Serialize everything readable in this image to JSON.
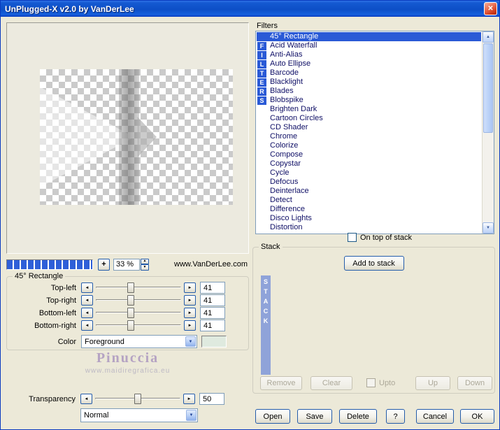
{
  "window": {
    "title": "UnPlugged-X v2.0 by VanDerLee"
  },
  "icons": {
    "close": "✕",
    "left": "◄",
    "right": "►",
    "up": "▲",
    "down": "▼",
    "dropdown": "▼",
    "plus": "+"
  },
  "preview": {
    "zoom": "33 %",
    "website": "www.VanDerLee.com"
  },
  "filters": {
    "label": "Filters",
    "letters": [
      "F",
      "I",
      "L",
      "T",
      "E",
      "R",
      "S"
    ],
    "items": [
      "45° Rectangle",
      "Acid Waterfall",
      "Anti-Alias",
      "Auto Ellipse",
      "Barcode",
      "Blacklight",
      "Blades",
      "Blobspike",
      "Brighten Dark",
      "Cartoon Circles",
      "CD Shader",
      "Chrome",
      "Colorize",
      "Compose",
      "Copystar",
      "Cycle",
      "Defocus",
      "Deinterlace",
      "Detect",
      "Difference",
      "Disco Lights",
      "Distortion"
    ],
    "selected_item": "45° Rectangle",
    "on_top_label": "On top of stack"
  },
  "settings": {
    "group_title": "45° Rectangle",
    "sliders": [
      {
        "label": "Top-left",
        "value": "41"
      },
      {
        "label": "Top-right",
        "value": "41"
      },
      {
        "label": "Bottom-left",
        "value": "41"
      },
      {
        "label": "Bottom-right",
        "value": "41"
      }
    ],
    "color_label": "Color",
    "color_value": "Foreground",
    "transparency": {
      "label": "Transparency",
      "value": "50"
    },
    "blend_mode": "Normal"
  },
  "watermark": {
    "name": "Pinuccia",
    "site": "www.maidiregrafica.eu"
  },
  "stack": {
    "group_title": "Stack",
    "add_button": "Add to stack",
    "letters": [
      "S",
      "T",
      "A",
      "C",
      "K"
    ],
    "remove": "Remove",
    "clear": "Clear",
    "upto": "Upto",
    "up": "Up",
    "down": "Down"
  },
  "footer": {
    "open": "Open",
    "save": "Save",
    "delete": "Delete",
    "help": "?",
    "cancel": "Cancel",
    "ok": "OK"
  },
  "colors": {
    "titlebar": "#0d4fc7",
    "selection": "#2a5ad6",
    "dialog_bg": "#ece9d8",
    "stack_bar": "#8fa3d9",
    "color_swatch": "#dfeadf"
  }
}
